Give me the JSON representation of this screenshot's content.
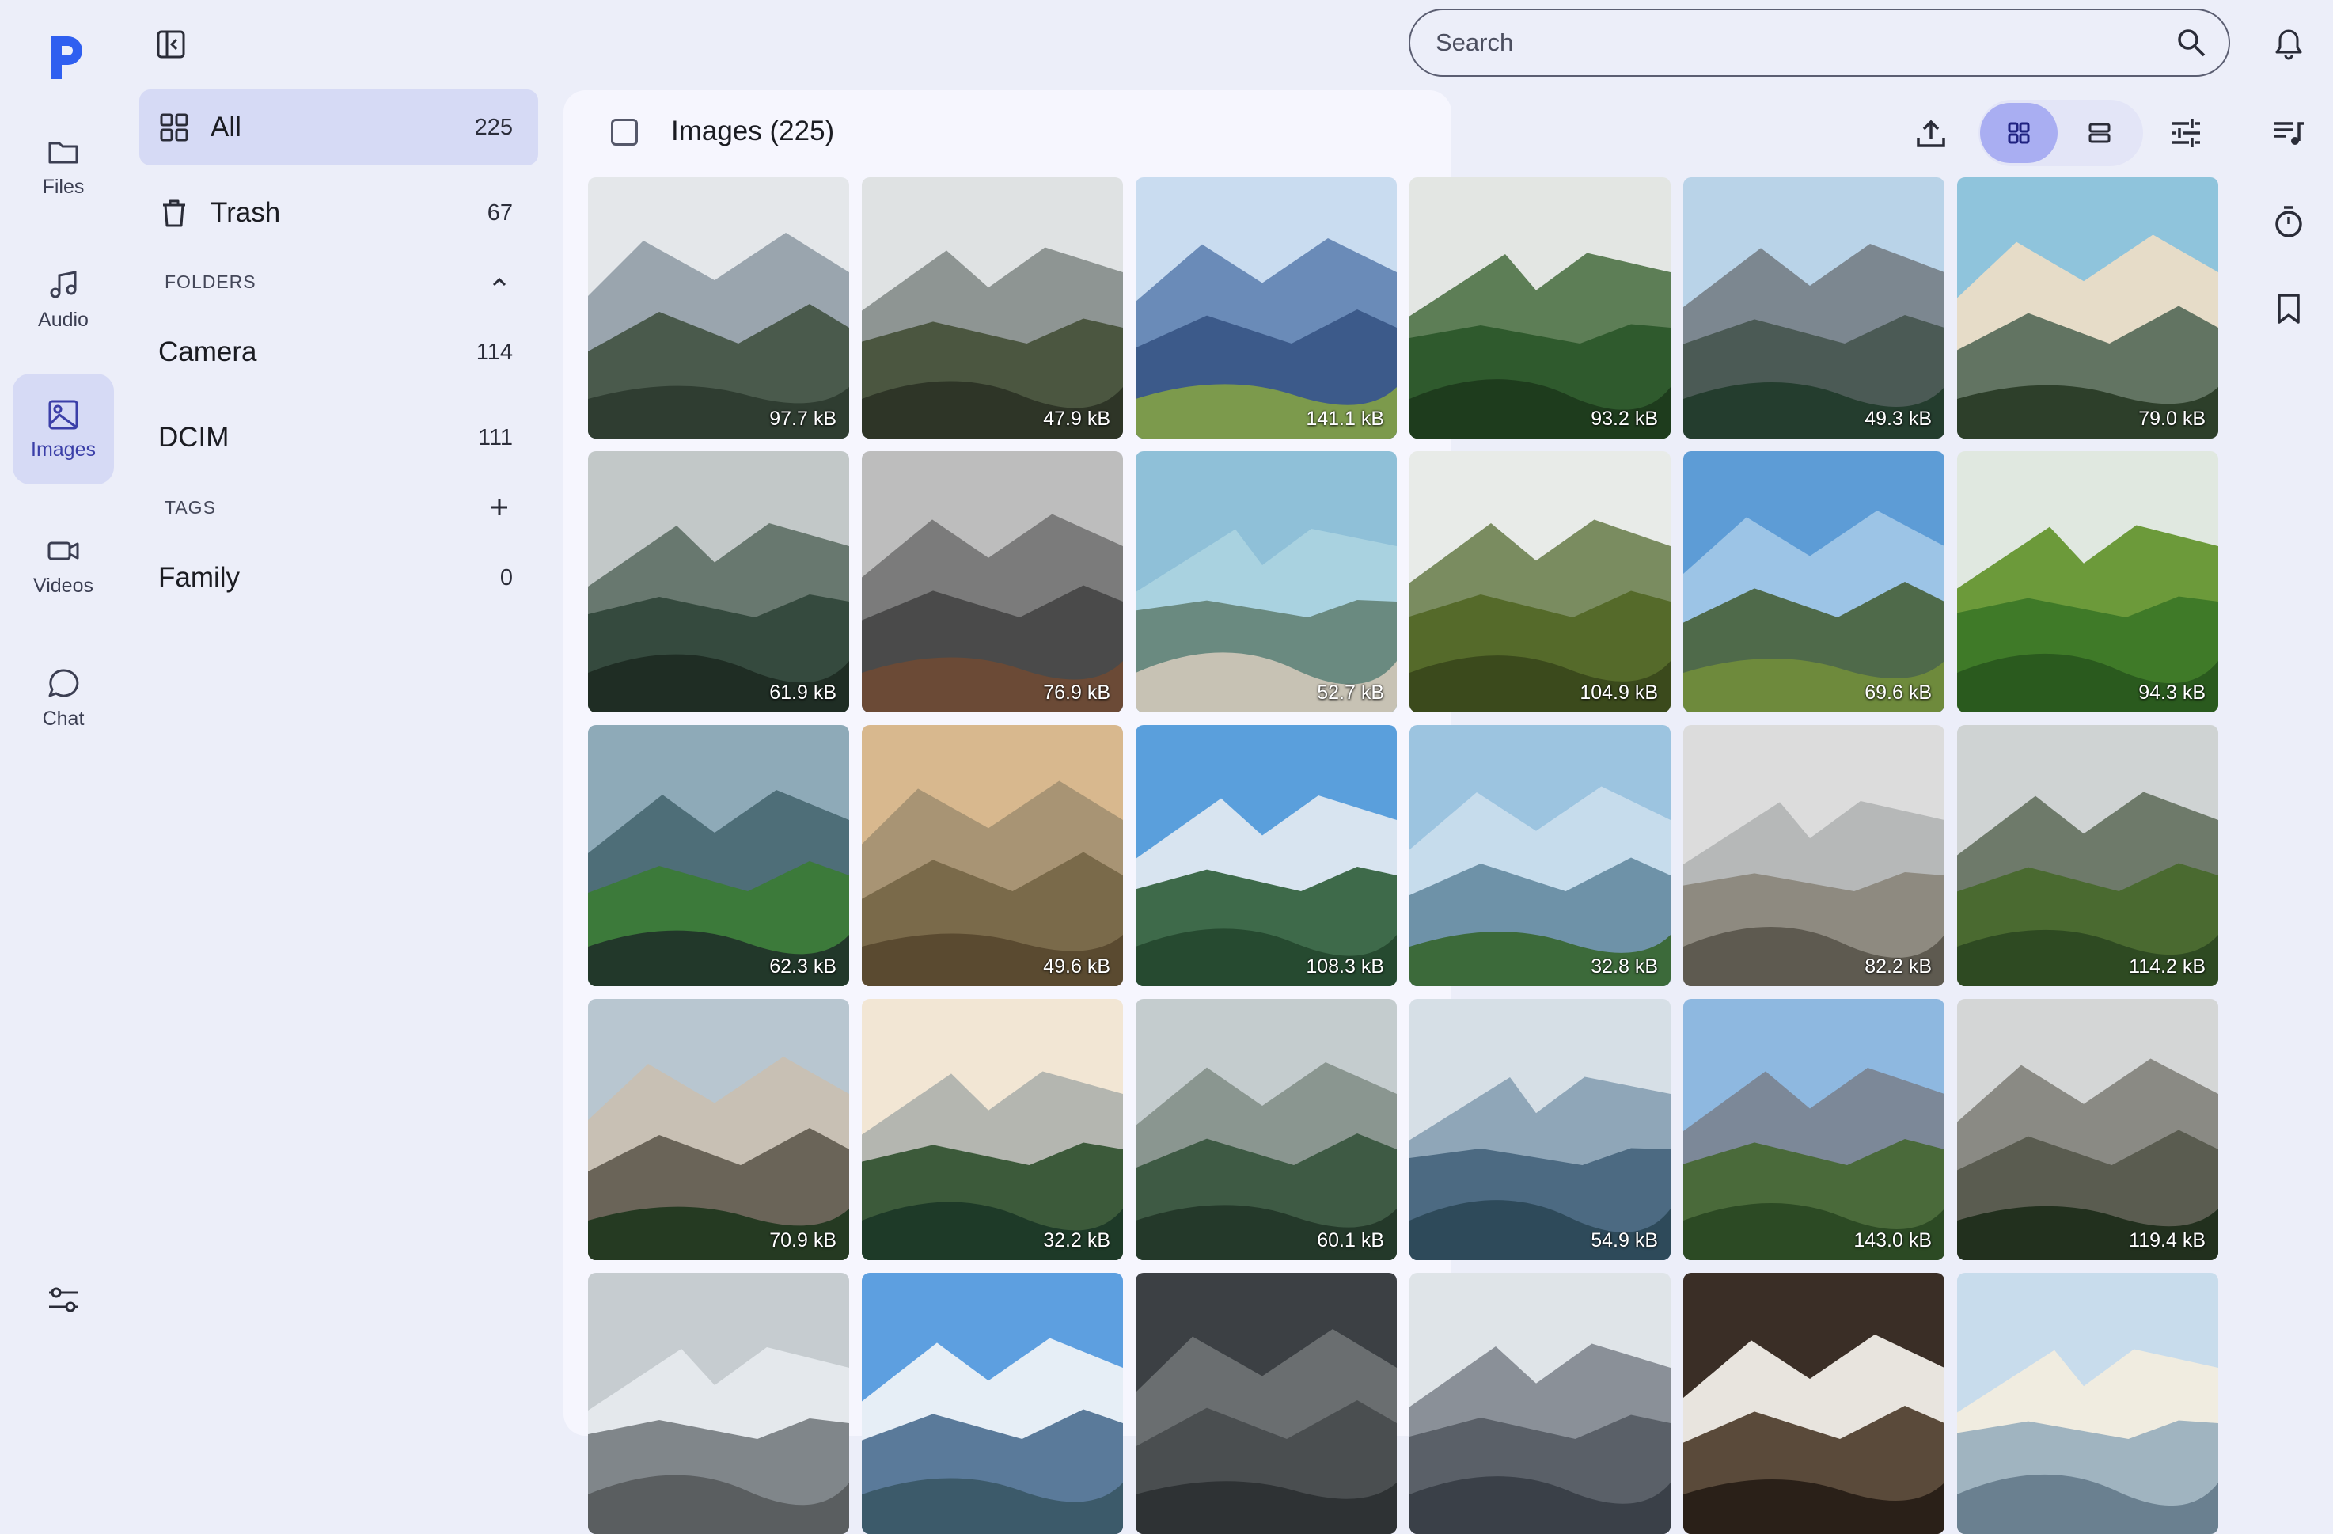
{
  "app": {
    "nav": [
      {
        "label": "Files",
        "icon": "folder-icon"
      },
      {
        "label": "Audio",
        "icon": "music-note-icon"
      },
      {
        "label": "Images",
        "icon": "image-icon",
        "active": true
      },
      {
        "label": "Videos",
        "icon": "video-camera-icon"
      },
      {
        "label": "Chat",
        "icon": "chat-bubble-icon"
      }
    ],
    "accent": "#3b3fa8",
    "active_bg": "#d6daf5"
  },
  "sidebar": {
    "all": {
      "label": "All",
      "count": "225"
    },
    "trash": {
      "label": "Trash",
      "count": "67"
    },
    "folders_header": "FOLDERS",
    "folders": [
      {
        "label": "Camera",
        "count": "114"
      },
      {
        "label": "DCIM",
        "count": "111"
      }
    ],
    "tags_header": "TAGS",
    "tags": [
      {
        "label": "Family",
        "count": "0"
      }
    ]
  },
  "search": {
    "placeholder": "Search"
  },
  "main": {
    "title": "Images (225)",
    "tiles": [
      {
        "size": "97.7 kB",
        "sky": "#e4e7ea",
        "far": "#9aa5ae",
        "near": "#4a5a4c",
        "ground": "#2f3d31"
      },
      {
        "size": "47.9 kB",
        "sky": "#dfe2e3",
        "far": "#8e9593",
        "near": "#4b5640",
        "ground": "#2e3527"
      },
      {
        "size": "141.1 kB",
        "sky": "#c9dcf0",
        "far": "#6a8bb8",
        "near": "#3c5a8a",
        "ground": "#7c9a4c"
      },
      {
        "size": "93.2 kB",
        "sky": "#e3e6e3",
        "far": "#5d7e56",
        "near": "#2f5a2d",
        "ground": "#1e3c1d"
      },
      {
        "size": "49.3 kB",
        "sky": "#b9d3e8",
        "far": "#7c8790",
        "near": "#4b5a55",
        "ground": "#243d2e"
      },
      {
        "size": "79.0 kB",
        "sky": "#8fc4dc",
        "far": "#e6dcc8",
        "near": "#627462",
        "ground": "#2d3f2a"
      },
      {
        "size": "61.9 kB",
        "sky": "#c2c8c8",
        "far": "#68786f",
        "near": "#354a3e",
        "ground": "#1f2d24"
      },
      {
        "size": "76.9 kB",
        "sky": "#bdbdbd",
        "far": "#7b7b7b",
        "near": "#4a4a4a",
        "ground": "#6b4a36"
      },
      {
        "size": "52.7 kB",
        "sky": "#8fc0d8",
        "far": "#a9d2e0",
        "near": "#6a8a80",
        "ground": "#c7c2b4"
      },
      {
        "size": "104.9 kB",
        "sky": "#e8ebe8",
        "far": "#7a8c60",
        "near": "#556a2a",
        "ground": "#3b4a1c"
      },
      {
        "size": "69.6 kB",
        "sky": "#5d9cd6",
        "far": "#9cc4e6",
        "near": "#4f6a4a",
        "ground": "#6e8a3c"
      },
      {
        "size": "94.3 kB",
        "sky": "#e0e8e0",
        "far": "#6c9a3a",
        "near": "#3f7a28",
        "ground": "#2a5a1e"
      },
      {
        "size": "62.3 kB",
        "sky": "#8eaab8",
        "far": "#4e6e78",
        "near": "#3c7a3a",
        "ground": "#22382a"
      },
      {
        "size": "49.6 kB",
        "sky": "#d8b88e",
        "far": "#a89474",
        "near": "#7a6a4a",
        "ground": "#5a4a30"
      },
      {
        "size": "108.3 kB",
        "sky": "#5a9fdc",
        "far": "#d8e4f0",
        "near": "#3e6a4a",
        "ground": "#264a30"
      },
      {
        "size": "32.8 kB",
        "sky": "#9cc4e0",
        "far": "#c6dcec",
        "near": "#6e92a8",
        "ground": "#3c6a3a"
      },
      {
        "size": "82.2 kB",
        "sky": "#dcdcdc",
        "far": "#b6b8b8",
        "near": "#8e8a80",
        "ground": "#5e5a50"
      },
      {
        "size": "114.2 kB",
        "sky": "#cfd3d3",
        "far": "#6e7a6a",
        "near": "#4a6a30",
        "ground": "#2e4a22"
      },
      {
        "size": "70.9 kB",
        "sky": "#b8c6d0",
        "far": "#c8c0b4",
        "near": "#6a6458",
        "ground": "#253a22"
      },
      {
        "size": "32.2 kB",
        "sky": "#f2e6d4",
        "far": "#b4b6b0",
        "near": "#3c5a3a",
        "ground": "#1e3a28"
      },
      {
        "size": "60.1 kB",
        "sky": "#c4ccce",
        "far": "#8a9690",
        "near": "#3e5a44",
        "ground": "#24392a"
      },
      {
        "size": "54.9 kB",
        "sky": "#d6dfe6",
        "far": "#8fa6b8",
        "near": "#4c6a82",
        "ground": "#2e4a5a"
      },
      {
        "size": "143.0 kB",
        "sky": "#8eb8e0",
        "far": "#7c8898",
        "near": "#4a6a3a",
        "ground": "#2c4a24"
      },
      {
        "size": "119.4 kB",
        "sky": "#d4d6d6",
        "far": "#8a8a84",
        "near": "#5a5c50",
        "ground": "#22301e"
      },
      {
        "size": "",
        "sky": "#c6ccd0",
        "far": "#e4e8ec",
        "near": "#80868a",
        "ground": "#5a5e60"
      },
      {
        "size": "",
        "sky": "#5d9fe0",
        "far": "#e6eef6",
        "near": "#5a7a9a",
        "ground": "#3c5a6a"
      },
      {
        "size": "",
        "sky": "#3c4044",
        "far": "#6a6e70",
        "near": "#4a4e50",
        "ground": "#2e3234"
      },
      {
        "size": "",
        "sky": "#dfe4e8",
        "far": "#8a9098",
        "near": "#5a6068",
        "ground": "#3a4048"
      },
      {
        "size": "",
        "sky": "#3a2e26",
        "far": "#e8e4de",
        "near": "#5a4a3a",
        "ground": "#2a2018"
      },
      {
        "size": "",
        "sky": "#c8dcec",
        "far": "#f0ece0",
        "near": "#a0b4c0",
        "ground": "#6a8090"
      }
    ]
  }
}
